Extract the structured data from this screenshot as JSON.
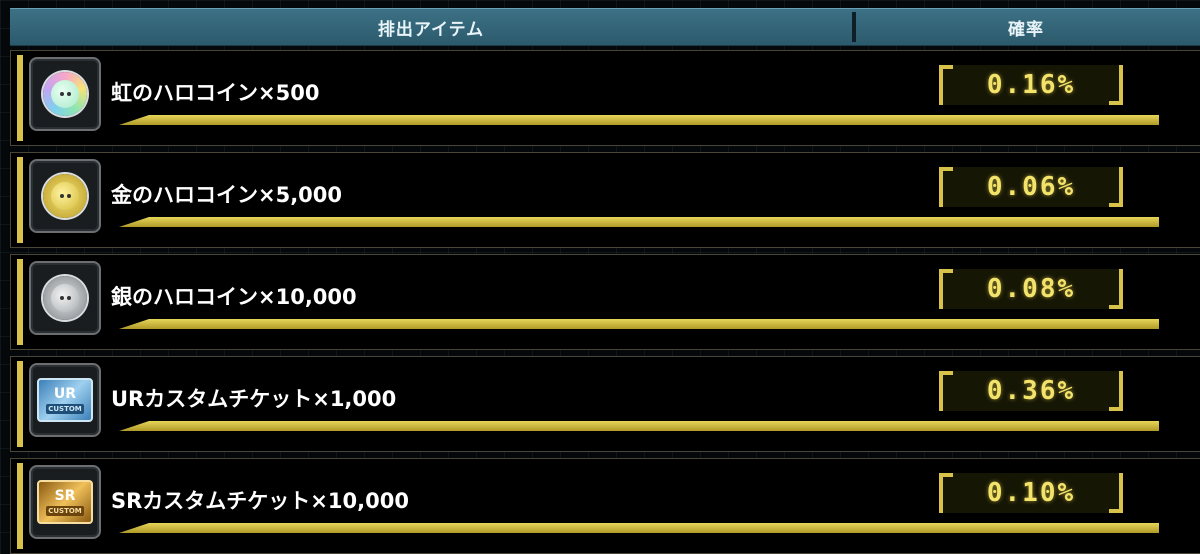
{
  "header": {
    "item_label": "排出アイテム",
    "rate_label": "確率"
  },
  "rows": [
    {
      "name": "虹のハロコイン×500",
      "rate": "0.16%",
      "icon": "rainbow-haro-coin-icon",
      "color": "#9fe0c8"
    },
    {
      "name": "金のハロコイン×5,000",
      "rate": "0.06%",
      "icon": "gold-haro-coin-icon",
      "color": "#e2cf4a"
    },
    {
      "name": "銀のハロコイン×10,000",
      "rate": "0.08%",
      "icon": "silver-haro-coin-icon",
      "color": "#b8bcbf"
    },
    {
      "name": "URカスタムチケット×1,000",
      "rate": "0.36%",
      "icon": "ur-custom-ticket-icon",
      "ticket_label": "UR",
      "ticket_sub": "CUSTOM",
      "color": "#5fa8d8"
    },
    {
      "name": "SRカスタムチケット×10,000",
      "rate": "0.10%",
      "icon": "sr-custom-ticket-icon",
      "ticket_label": "SR",
      "ticket_sub": "CUSTOM",
      "color": "#e0a83a"
    }
  ],
  "colors": {
    "accent": "#d8c24a",
    "header_bg": "#346577",
    "rate_text": "#f4e36a"
  }
}
